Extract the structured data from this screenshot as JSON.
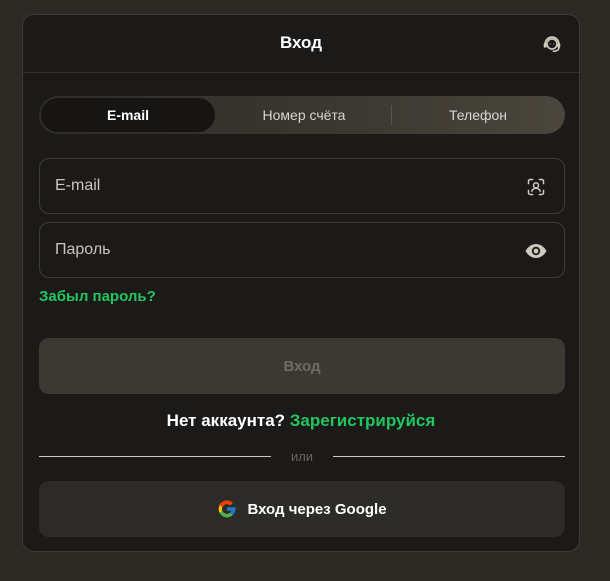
{
  "header": {
    "title": "Вход",
    "support_icon": "headset-icon"
  },
  "tabs": [
    {
      "label": "E-mail",
      "active": true
    },
    {
      "label": "Номер счёта",
      "active": false
    },
    {
      "label": "Телефон",
      "active": false
    }
  ],
  "email_field": {
    "placeholder": "E-mail",
    "value": "",
    "icon": "contact-scan-icon"
  },
  "password_field": {
    "placeholder": "Пароль",
    "value": "",
    "icon": "eye-icon"
  },
  "forgot_password": "Забыл пароль?",
  "submit_label": "Вход",
  "register": {
    "prompt": "Нет аккаунта?",
    "link": "Зарегистрируйся"
  },
  "divider_text": "или",
  "google": {
    "label": "Вход через Google",
    "icon": "google-icon"
  },
  "colors": {
    "accent": "#22c55e",
    "background": "#1b1a18",
    "page": "#2b2924"
  }
}
